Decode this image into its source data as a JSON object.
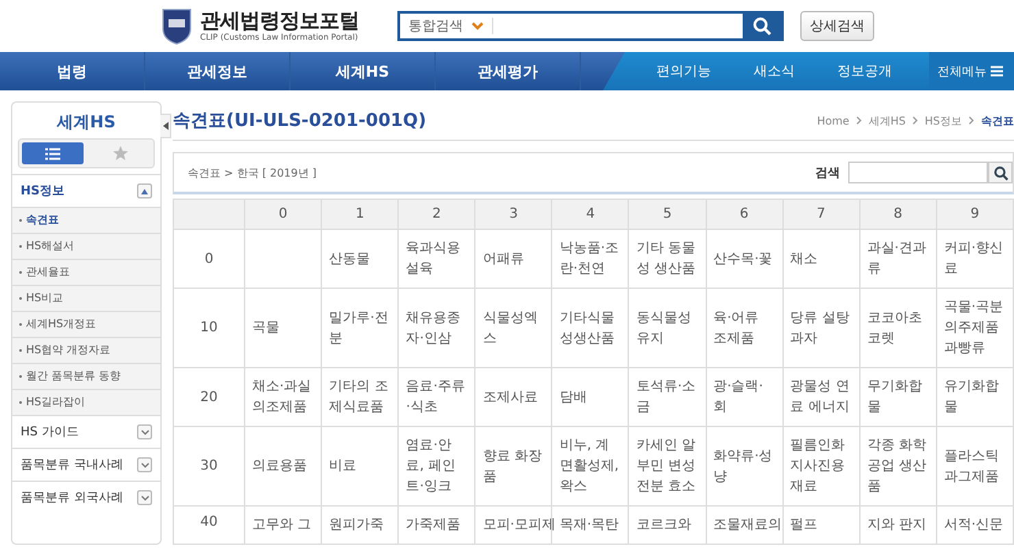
{
  "header": {
    "site_title": "관세법령정보포털",
    "site_subtitle": "CLIP (Customs Law Information Portal)",
    "search_scope": "통합검색",
    "search_button": "상세검색"
  },
  "nav": {
    "main": [
      {
        "label": "법령"
      },
      {
        "label": "관세정보"
      },
      {
        "label": "세계HS"
      },
      {
        "label": "관세평가"
      }
    ],
    "secondary": [
      {
        "label": "편의기능"
      },
      {
        "label": "새소식"
      },
      {
        "label": "정보공개"
      }
    ],
    "all_menu": "전체메뉴"
  },
  "sidebar": {
    "title": "세계HS",
    "toggle": [
      {
        "kind": "list",
        "selected": true
      },
      {
        "kind": "star",
        "selected": false
      }
    ],
    "sections": [
      {
        "label": "HS정보",
        "expanded": true,
        "children": [
          {
            "label": "속견표",
            "selected": true
          },
          {
            "label": "HS해설서",
            "selected": false
          },
          {
            "label": "관세율표",
            "selected": false
          },
          {
            "label": "HS비교",
            "selected": false
          },
          {
            "label": "세계HS개정표",
            "selected": false
          },
          {
            "label": "HS협약 개정자료",
            "selected": false
          },
          {
            "label": "월간 품목분류 동향",
            "selected": false
          },
          {
            "label": "HS길라잡이",
            "selected": false
          }
        ]
      },
      {
        "label": "HS 가이드",
        "expanded": false
      },
      {
        "label": "품목분류 국내사례",
        "expanded": false
      },
      {
        "label": "품목분류 외국사례",
        "expanded": false
      }
    ]
  },
  "page": {
    "title": "속견표(UI-ULS-0201-001Q)",
    "breadcrumb": [
      {
        "label": "Home",
        "current": false
      },
      {
        "label": "세계HS",
        "current": false
      },
      {
        "label": "HS정보",
        "current": false
      },
      {
        "label": "속견표",
        "current": true
      }
    ],
    "filter": {
      "path": "속견표 > 한국 [ 2019년 ]",
      "search_label": "검색"
    },
    "table": {
      "columns": [
        "0",
        "1",
        "2",
        "3",
        "4",
        "5",
        "6",
        "7",
        "8",
        "9"
      ],
      "rows": [
        {
          "head": "0",
          "cut": false,
          "cells": [
            "",
            "산동물",
            "육과식용설육",
            "어패류",
            "낙농품·조란·천연",
            "기타 동물성 생산품",
            "산수목·꽃",
            "채소",
            "과실·견과류",
            "커피·향신료"
          ]
        },
        {
          "head": "10",
          "cut": false,
          "cells": [
            "곡물",
            "밀가루·전분",
            "채유용종자·인삼",
            "식물성엑스",
            "기타식물성생산품",
            "동식물성유지",
            "육·어류 조제품",
            "당류 설탕과자",
            "코코아초코렛",
            "곡물·곡분의주제품과빵류"
          ]
        },
        {
          "head": "20",
          "cut": false,
          "cells": [
            "채소·과실의조제품",
            "기타의 조제식료품",
            "음료·주류·식초",
            "조제사료",
            "담배",
            "토석류·소금",
            "광·슬랙·회",
            "광물성 연료 에너지",
            "무기화합물",
            "유기화합물"
          ]
        },
        {
          "head": "30",
          "cut": false,
          "cells": [
            "의료용품",
            "비료",
            "염료·안료, 페인트·잉크",
            "향료 화장품",
            "비누, 계면활성제, 왁스",
            "카세인 알부민 변성 전분 효소",
            "화약류·성냥",
            "필름인화지사진용재료",
            "각종 화학공업 생산품",
            "플라스틱과그제품"
          ]
        },
        {
          "head": "40",
          "cut": true,
          "cells": [
            "고무와 그",
            "원피가죽",
            "가죽제품",
            "모피·모피제",
            "목재·목탄",
            "코르크와",
            "조물재료의",
            "펄프",
            "지와 판지",
            "서적·신문"
          ]
        }
      ]
    }
  }
}
